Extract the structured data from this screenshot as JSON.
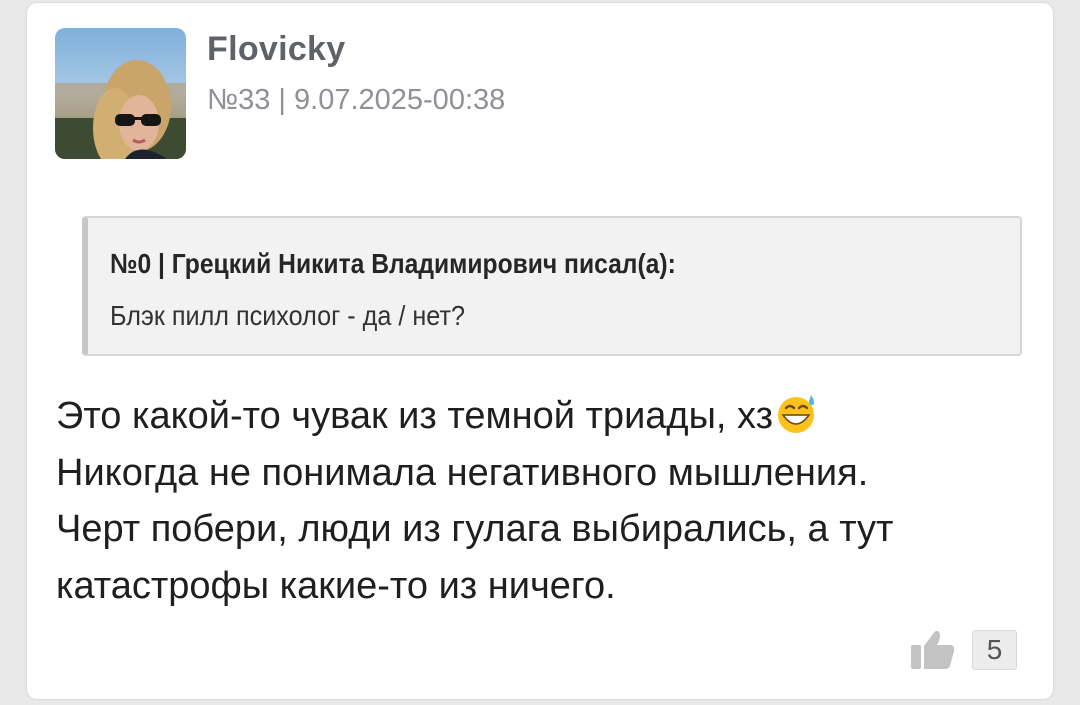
{
  "post": {
    "author": "Flovicky",
    "meta": "№33 | 9.07.2025-00:38",
    "quote": {
      "header": "№0 | Грецкий Никита Владимирович писал(а):",
      "text": "Блэк пилл психолог - да / нет?"
    },
    "body_lines": [
      "Это какой-то чувак из темной триады, хз",
      "Никогда не понимала негативного мышления.",
      "Черт побери, люди из гулага выбирались, а тут",
      "катастрофы какие-то из ничего."
    ],
    "emoji": "grinning-face-with-sweat-emoji",
    "likes": "5"
  },
  "icons": {
    "like": "thumbs-up-icon"
  },
  "colors": {
    "page_bg": "#e9e9ea",
    "card_bg": "#ffffff",
    "quote_bg": "#f2f2f2",
    "author_text": "#5f6368",
    "meta_text": "#8e9196"
  }
}
